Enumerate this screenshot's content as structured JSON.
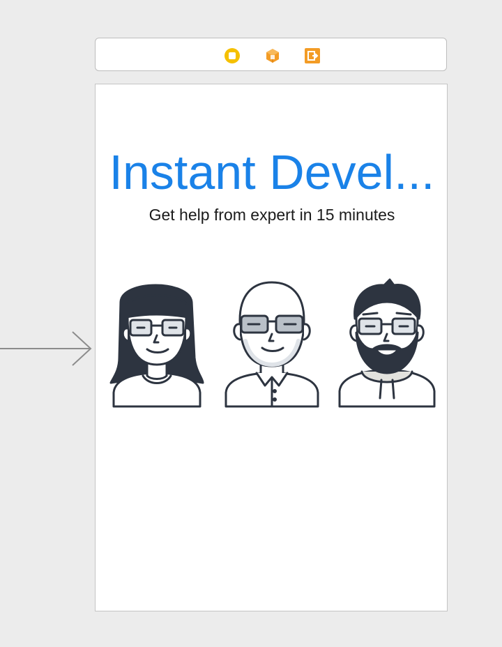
{
  "scene_dock": {
    "icons": [
      "view-controller-icon",
      "first-responder-icon",
      "exit-icon"
    ],
    "colors": {
      "view_controller": "#f5c000",
      "first_responder": "#f39c26",
      "exit": "#f39c26"
    }
  },
  "storyboard": {
    "is_initial_view_controller": true
  },
  "view": {
    "title": "Instant Devel...",
    "subtitle": "Get help from expert in 15 minutes",
    "avatars": [
      "female-developer-avatar",
      "bald-developer-avatar",
      "bearded-developer-avatar"
    ]
  },
  "colors": {
    "title": "#1a82e8",
    "subtitle": "#1b1b1b",
    "illustration_stroke": "#2d3440",
    "canvas_background": "#ececec"
  }
}
